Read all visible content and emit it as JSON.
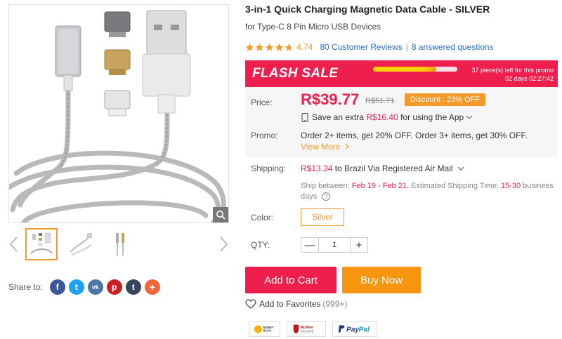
{
  "product": {
    "title": "3-in-1 Quick Charging Magnetic Data Cable - SILVER",
    "subtitle": "for Type-C 8 Pin Micro USB Devices",
    "rating": "4.74",
    "reviews": "80 Customer Reviews",
    "questions": "8 answered questions",
    "star_count": 4.74
  },
  "flash_sale": {
    "title": "FLASH SALE",
    "pieces_left": "37 piece(s) left for this promo",
    "time_left": "02 days 02:27:42",
    "progress_fraction": 0.75
  },
  "price": {
    "label": "Price:",
    "current": "R$39.77",
    "original": "R$51.71",
    "discount": "Discount : 23% OFF",
    "app_prefix": "Save an extra",
    "app_amount": "R$16.40",
    "app_suffix": "for using the App"
  },
  "promo": {
    "label": "Promo:",
    "text": "Order 2+ items, get 20% OFF. Order 3+ items, get 30% OFF.",
    "view_more": "View More"
  },
  "shipping": {
    "label": "Shipping:",
    "cost": "R$13.34",
    "method": "to Brazil Via Registered Air Mail",
    "between_label": "Ship between:",
    "between_dates": "Feb 19 - Feb 21",
    "estimated_label": ", Estimated Shipping Time:",
    "estimated_range": "15-30",
    "estimated_unit": "business days"
  },
  "color": {
    "label": "Color:",
    "selected": "Silver"
  },
  "qty": {
    "label": "QTY:",
    "value": "1",
    "minus": "—",
    "plus": "+"
  },
  "actions": {
    "add_to_cart": "Add to Cart",
    "buy_now": "Buy Now",
    "favorites": "Add to Favorites",
    "favorites_count": "(999+)"
  },
  "share": {
    "label": "Share to:",
    "networks": [
      "f",
      "t",
      "vk",
      "p",
      "t",
      "+"
    ]
  },
  "badges": {
    "money_back": "MONEY BACK",
    "mcafee": "McAfee SECURE",
    "paypal": "PayPal"
  },
  "colors": {
    "accent_red": "#ef1f4d",
    "accent_orange": "#f39a2b",
    "link_blue": "#2a70c0"
  }
}
